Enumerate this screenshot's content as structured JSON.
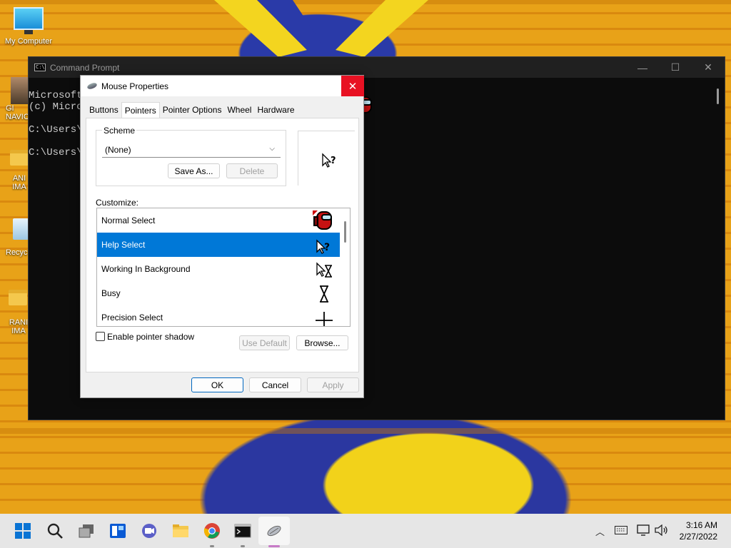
{
  "desktop": {
    "icons": [
      {
        "label": "My Computer"
      },
      {
        "label": "GI\nNAVIC"
      },
      {
        "label": "ANI\nIMA"
      },
      {
        "label": "Recyc"
      },
      {
        "label": "RANI\nIMA"
      }
    ]
  },
  "cmd": {
    "title": "Command Prompt",
    "lines": [
      "Microsoft",
      "(c) Micro",
      "",
      "C:\\Users\\",
      "",
      "C:\\Users\\"
    ]
  },
  "dialog": {
    "title": "Mouse Properties",
    "close_glyph": "✕",
    "tabs": [
      "Buttons",
      "Pointers",
      "Pointer Options",
      "Wheel",
      "Hardware"
    ],
    "active_tab": "Pointers",
    "scheme_label": "Scheme",
    "scheme_value": "(None)",
    "save_as": "Save As...",
    "delete": "Delete",
    "customize_label": "Customize:",
    "pointers": [
      {
        "name": "Normal Select",
        "icon": "red-crewmate-cursor-icon",
        "selected": false
      },
      {
        "name": "Help Select",
        "icon": "help-cursor-icon",
        "selected": true
      },
      {
        "name": "Working In Background",
        "icon": "working-cursor-icon",
        "selected": false
      },
      {
        "name": "Busy",
        "icon": "hourglass-icon",
        "selected": false
      },
      {
        "name": "Precision Select",
        "icon": "crosshair-icon",
        "selected": false
      }
    ],
    "shadow_label": "Enable pointer shadow",
    "shadow_checked": false,
    "use_default": "Use Default",
    "browse": "Browse...",
    "ok": "OK",
    "cancel": "Cancel",
    "apply": "Apply"
  },
  "taskbar": {
    "icons": [
      "start-icon",
      "search-icon",
      "task-view-icon",
      "widgets-icon",
      "teams-chat-icon",
      "file-explorer-icon",
      "chrome-icon",
      "command-prompt-icon",
      "mouse-properties-icon"
    ],
    "clock_time": "3:16 AM",
    "clock_date": "2/27/2022"
  },
  "colors": {
    "accent": "#0078d7",
    "close_red": "#e81123"
  }
}
